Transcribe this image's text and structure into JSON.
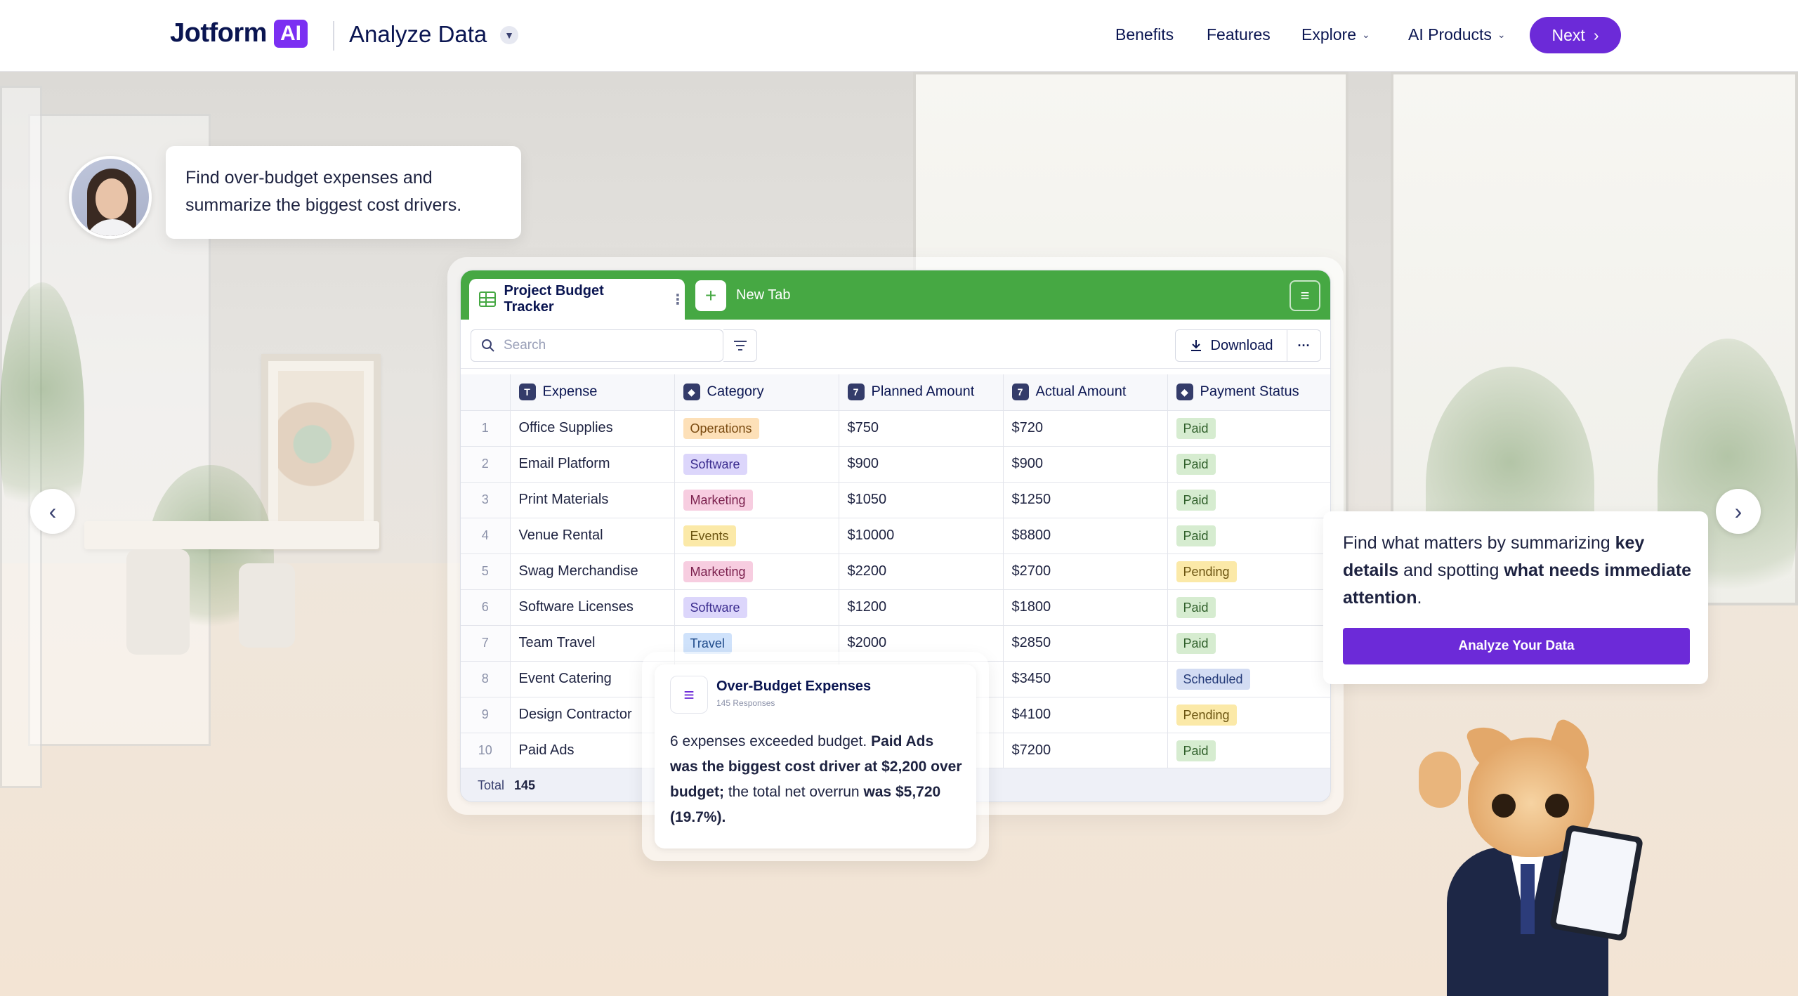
{
  "header": {
    "brand_name": "Jotform",
    "brand_badge": "AI",
    "product_title": "Analyze Data",
    "nav": [
      {
        "label": "Benefits",
        "has_chevron": false
      },
      {
        "label": "Features",
        "has_chevron": false
      },
      {
        "label": "Explore",
        "has_chevron": true
      },
      {
        "label": "AI Products",
        "has_chevron": true
      }
    ],
    "next_label": "Next",
    "accent_color": "#6c2ad8"
  },
  "prompt": {
    "text": "Find over-budget expenses and summarize the biggest cost drivers."
  },
  "sheet": {
    "tab_label": "Project Budget Tracker",
    "new_tab_label": "New Tab",
    "search_placeholder": "Search",
    "download_label": "Download",
    "tab_color": "#46a843",
    "columns": [
      {
        "icon": "T",
        "label": "Expense"
      },
      {
        "icon": "tag",
        "label": "Category"
      },
      {
        "icon": "7",
        "label": "Planned Amount"
      },
      {
        "icon": "7",
        "label": "Actual Amount"
      },
      {
        "icon": "tag",
        "label": "Payment Status"
      }
    ],
    "rows": [
      {
        "n": "1",
        "expense": "Office Supplies",
        "category": "Operations",
        "planned": "$750",
        "actual": "$720",
        "status": "Paid"
      },
      {
        "n": "2",
        "expense": "Email Platform",
        "category": "Software",
        "planned": "$900",
        "actual": "$900",
        "status": "Paid"
      },
      {
        "n": "3",
        "expense": "Print Materials",
        "category": "Marketing",
        "planned": "$1050",
        "actual": "$1250",
        "status": "Paid"
      },
      {
        "n": "4",
        "expense": "Venue Rental",
        "category": "Events",
        "planned": "$10000",
        "actual": "$8800",
        "status": "Paid"
      },
      {
        "n": "5",
        "expense": "Swag Merchandise",
        "category": "Marketing",
        "planned": "$2200",
        "actual": "$2700",
        "status": "Pending"
      },
      {
        "n": "6",
        "expense": "Software Licenses",
        "category": "Software",
        "planned": "$1200",
        "actual": "$1800",
        "status": "Paid"
      },
      {
        "n": "7",
        "expense": "Team Travel",
        "category": "Travel",
        "planned": "$2000",
        "actual": "$2850",
        "status": "Paid"
      },
      {
        "n": "8",
        "expense": "Event Catering",
        "category": "",
        "planned": "",
        "actual": "$3450",
        "status": "Scheduled"
      },
      {
        "n": "9",
        "expense": "Design Contractor",
        "category": "",
        "planned": "",
        "actual": "$4100",
        "status": "Pending"
      },
      {
        "n": "10",
        "expense": "Paid Ads",
        "category": "",
        "planned": "",
        "actual": "$7200",
        "status": "Paid"
      }
    ],
    "total_label": "Total",
    "total_value": "145",
    "category_colors": {
      "Operations": {
        "bg": "#fde0b8",
        "fg": "#7a4a10"
      },
      "Software": {
        "bg": "#dcd6fb",
        "fg": "#3b2c8f"
      },
      "Marketing": {
        "bg": "#f7cde0",
        "fg": "#7a1f4c"
      },
      "Events": {
        "bg": "#fbe9a8",
        "fg": "#6b5410"
      },
      "Travel": {
        "bg": "#cfe2fb",
        "fg": "#1e4a8a"
      }
    },
    "status_colors": {
      "Paid": {
        "bg": "#d6ecd0",
        "fg": "#2f5f2a"
      },
      "Pending": {
        "bg": "#fbe9a8",
        "fg": "#6b5410"
      },
      "Scheduled": {
        "bg": "#d3dcf3",
        "fg": "#243a78"
      }
    }
  },
  "result": {
    "title": "Over-Budget Expenses",
    "subtitle": "145 Responses",
    "body_parts": [
      {
        "text": "6 expenses exceeded budget. ",
        "bold": false
      },
      {
        "text": "Paid Ads was the biggest cost driver at $2,200 over budget;",
        "bold": true
      },
      {
        "text": " the total net overrun ",
        "bold": false
      },
      {
        "text": "was $5,720 (19.7%).",
        "bold": true
      }
    ]
  },
  "info_card": {
    "text_parts": [
      {
        "text": "Find what matters by summarizing ",
        "bold": false
      },
      {
        "text": "key details",
        "bold": true
      },
      {
        "text": " and spotting ",
        "bold": false
      },
      {
        "text": "what needs immediate attention",
        "bold": true
      },
      {
        "text": ".",
        "bold": false
      }
    ],
    "button_label": "Analyze Your Data"
  },
  "icons": {
    "prev": "chevron-left-icon",
    "next": "chevron-right-icon",
    "search": "search-icon",
    "filter": "filter-icon",
    "download": "download-icon",
    "more": "more-dots-icon",
    "menu": "hamburger-icon",
    "add": "plus-icon"
  }
}
